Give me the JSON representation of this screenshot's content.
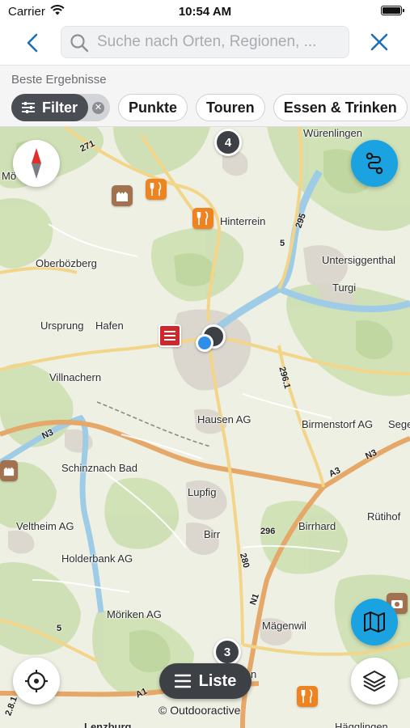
{
  "status_bar": {
    "carrier": "Carrier",
    "time": "10:54 AM"
  },
  "search": {
    "placeholder": "Suche nach Orten, Regionen, ...",
    "value": ""
  },
  "results": {
    "section_label": "Beste Ergebnisse",
    "filter_chip": "Filter",
    "chips": [
      "Punkte",
      "Touren",
      "Essen & Trinken"
    ]
  },
  "map": {
    "places": [
      "Würenlingen",
      "Mö",
      "Hinterrein",
      "Oberbözberg",
      "Untersiggenthal",
      "Turgi",
      "Ursprung",
      "Hafen",
      "Villnachern",
      "Hausen AG",
      "Birmenstorf AG",
      "Sege",
      "Schinznach Bad",
      "Lupfig",
      "Rütihof",
      "Veltheim AG",
      "Birr",
      "Birrhard",
      "Holderbank AG",
      "Möriken AG",
      "Mägenwil",
      "n",
      "Lenzburg",
      "Hägglingen"
    ],
    "road_numbers": [
      "271",
      "295",
      "5",
      "296.1",
      "N3",
      "N3",
      "A3",
      "296",
      "280",
      "N1",
      "5",
      "A1",
      "2.8.1"
    ],
    "clusters": [
      "4",
      "3"
    ],
    "list_button": "Liste",
    "attribution": "© Outdooractive"
  },
  "colors": {
    "accent_blue": "#1aa3e0",
    "chip_active": "#4a4e54",
    "food_poi": "#ee8421",
    "hotel_poi": "#d0272b"
  }
}
